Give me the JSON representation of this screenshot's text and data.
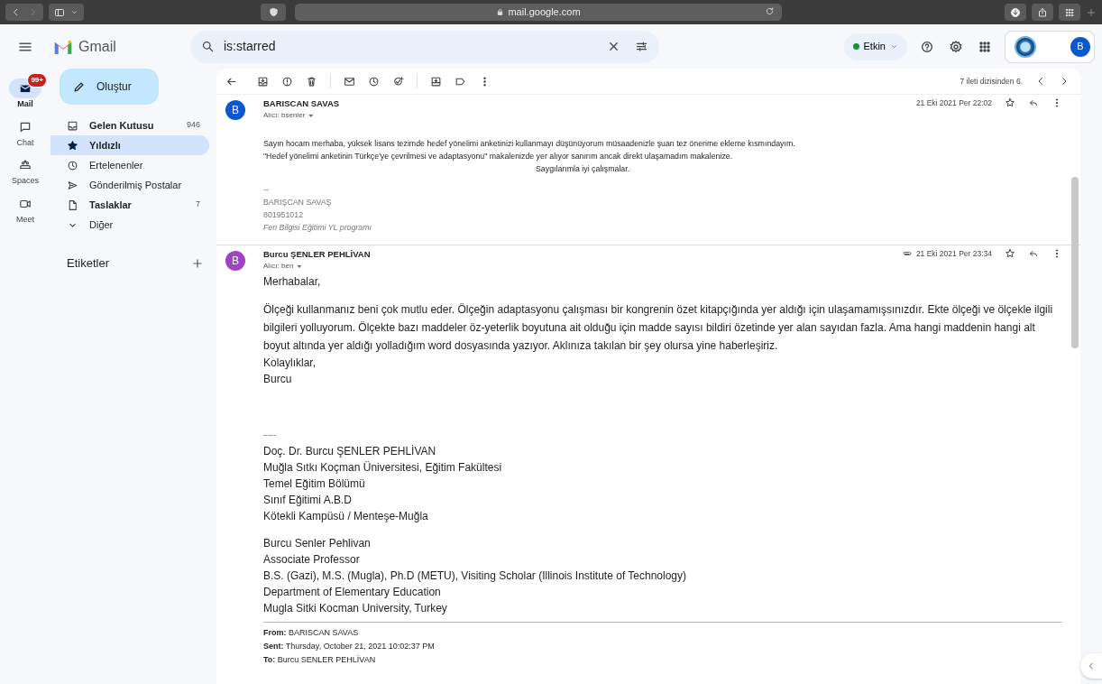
{
  "browser": {
    "url": "mail.google.com"
  },
  "header": {
    "app_name": "Gmail",
    "search": {
      "value": "is:starred"
    },
    "status": {
      "label": "Etkin",
      "color": "#1e8e3e"
    },
    "avatar_letter": "B"
  },
  "rail": [
    {
      "label": "Mail",
      "selected": true,
      "badge": "99+"
    },
    {
      "label": "Chat",
      "selected": false
    },
    {
      "label": "Spaces",
      "selected": false
    },
    {
      "label": "Meet",
      "selected": false
    }
  ],
  "nav": {
    "compose": "Oluştur",
    "items": [
      {
        "label": "Gelen Kutusu",
        "count": "946",
        "unread": true,
        "selected": false
      },
      {
        "label": "Yıldızlı",
        "unread": true,
        "selected": true
      },
      {
        "label": "Ertelenenler",
        "unread": false,
        "selected": false
      },
      {
        "label": "Gönderilmiş Postalar",
        "unread": false,
        "selected": false
      },
      {
        "label": "Taslaklar",
        "count": "7",
        "unread": true,
        "selected": false
      },
      {
        "label": "Diğer",
        "unread": false,
        "selected": false
      }
    ],
    "labels_heading": "Etiketler"
  },
  "toolbar": {
    "counter": "7 ileti dizisinden 6."
  },
  "messages": [
    {
      "kind": "plain",
      "avatar_letter": "B",
      "color": "#0b57d0",
      "sender": "BARISCAN SAVAS",
      "recipient": "Alıcı: bsenler",
      "date": "21 Eki 2021 Per 22:02",
      "attachment": false,
      "body": [
        {
          "kind": "line",
          "text": "Sayın hocam merhaba, yüksek lisans tezimde hedef yönelimi anketinizi kullanmayı düşünüyorum müsaadenizle şuan tez önerime ekleme kısmındayım."
        },
        {
          "kind": "line",
          "text": "\"Hedef yönelimi anketinin Türkçe'ye çevrilmesi ve adaptasyonu\" makalenizde yer alıyor sanırım ancak direkt ulaşamadım makalenize."
        },
        {
          "kind": "indent",
          "text": "Saygılarımla iyi çalışmalar."
        },
        {
          "kind": "muted",
          "text": "--"
        },
        {
          "kind": "muted",
          "text": "BARIŞCAN SAVAŞ"
        },
        {
          "kind": "muted",
          "text": "801951012"
        },
        {
          "kind": "note",
          "text": "Fen Bilgisi Eğitimi YL programı"
        }
      ]
    },
    {
      "kind": "formatted",
      "avatar_letter": "B",
      "color": "#a142c4",
      "sender": "Burcu ŞENLER PEHLİVAN",
      "recipient": "Alıcı: ben",
      "date": "21 Eki 2021 Per 23:34",
      "attachment": true,
      "body": [
        {
          "kind": "line",
          "text": "Merhabalar,"
        },
        {
          "kind": "line",
          "text": "Ölçeği kullanmanız beni çok mutlu eder. Ölçeğin adaptasyonu çalışması bir kongrenin özet kitapçığında yer aldığı için ulaşamamışsınızdır.  Ekte ölçeği ve ölçekle ilgili bilgileri yolluyorum. Ölçekte bazı maddeler öz-yeterlik boyutuna ait olduğu için madde sayısı bildiri özetinde yer alan sayıdan fazla. Ama hangi maddenin hangi alt boyut altında yer aldığı yolladığım word dosyasında yazıyor. Aklınıza takılan bir şey olursa yine haberleşiriz."
        },
        {
          "kind": "line",
          "text": "Kolaylıklar,"
        },
        {
          "kind": "line",
          "text": "Burcu"
        },
        {
          "kind": "small",
          "text": "------"
        },
        {
          "kind": "line",
          "text": "Doç. Dr. Burcu ŞENLER PEHLİVAN"
        },
        {
          "kind": "line",
          "text": "Muğla Sıtkı Koçman Üniversitesi, Eğitim Fakültesi"
        },
        {
          "kind": "line",
          "text": "Temel Eğitim Bölümü"
        },
        {
          "kind": "line",
          "text": "Sınıf Eğitimi A.B.D"
        },
        {
          "kind": "line",
          "text": "Kötekli Kampüsü / Menteşe-Muğla"
        },
        {
          "kind": "line",
          "text": "Burcu Senler Pehlivan"
        },
        {
          "kind": "line",
          "text": "Associate Professor"
        },
        {
          "kind": "line",
          "text": "B.S. (Gazi), M.S. (Mugla), Ph.D (METU), Visiting Scholar (Illinois Institute of Technology)"
        },
        {
          "kind": "line",
          "text": "Department of Elementary Education"
        },
        {
          "kind": "line",
          "text": "Mugla Sitki Kocman University, Turkey"
        },
        {
          "kind": "rule"
        },
        {
          "kind": "quote",
          "text": "**From:** BARISCAN SAVAS"
        },
        {
          "kind": "quote",
          "text": "**Sent:** Thursday, October 21, 2021 10:02:37 PM"
        },
        {
          "kind": "quote",
          "text": "**To:** Burcu SENLER PEHLİVAN"
        }
      ]
    }
  ]
}
